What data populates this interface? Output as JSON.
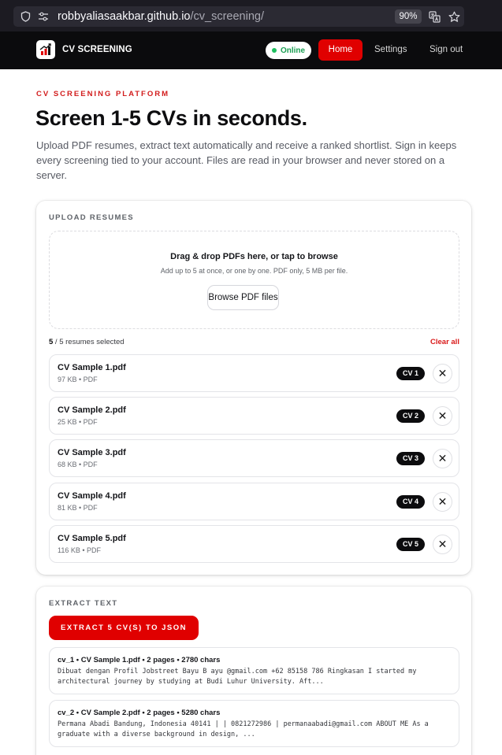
{
  "browser": {
    "url_host": "robbyaliasaakbar.github.io",
    "url_path": "/cv_screening/",
    "zoom": "90%"
  },
  "header": {
    "brand": "CV SCREENING",
    "status": "Online",
    "nav": {
      "home": "Home",
      "settings": "Settings",
      "signout": "Sign out"
    }
  },
  "hero": {
    "eyebrow": "CV SCREENING PLATFORM",
    "title": "Screen 1-5 CVs in seconds.",
    "description": "Upload PDF resumes, extract text automatically and receive a ranked shortlist. Sign in keeps every screening tied to your account. Files are read in your browser and never stored on a server."
  },
  "upload": {
    "section_title": "UPLOAD RESUMES",
    "dropzone_title": "Drag & drop PDFs here, or tap to browse",
    "dropzone_sub": "Add up to 5 at once, or one by one. PDF only, 5 MB per file.",
    "browse_label": "Browse PDF files",
    "selected_count": "5",
    "selected_suffix": " / 5 resumes selected",
    "clear_all": "Clear all",
    "remove_symbol": "✕",
    "files": [
      {
        "name": "CV Sample 1.pdf",
        "meta": "97 KB • PDF",
        "tag": "CV 1"
      },
      {
        "name": "CV Sample 2.pdf",
        "meta": "25 KB • PDF",
        "tag": "CV 2"
      },
      {
        "name": "CV Sample 3.pdf",
        "meta": "68 KB • PDF",
        "tag": "CV 3"
      },
      {
        "name": "CV Sample 4.pdf",
        "meta": "81 KB • PDF",
        "tag": "CV 4"
      },
      {
        "name": "CV Sample 5.pdf",
        "meta": "116 KB • PDF",
        "tag": "CV 5"
      }
    ]
  },
  "extract": {
    "section_title": "EXTRACT TEXT",
    "button_label": "EXTRACT 5 CV(S) TO JSON",
    "results": [
      {
        "head": "cv_1 • CV Sample 1.pdf • 2 pages • 2780 chars",
        "text": "Dibuat dengan Profil Jobstreet Bayu B ayu @gmail.com +62 85158 786 Ringkasan I started my architectural journey by studying at Budi Luhur University. Aft..."
      },
      {
        "head": "cv_2 • CV Sample 2.pdf • 2 pages • 5280 chars",
        "text": "Permana Abadi Bandung, Indonesia 40141 | | 0821272986 | permanaabadi@gmail.com ABOUT ME As a graduate with a diverse background in design, ..."
      }
    ]
  },
  "colors": {
    "accent": "#e00000",
    "header_bg": "#0b0b0d",
    "online": "#1fbf5f"
  }
}
